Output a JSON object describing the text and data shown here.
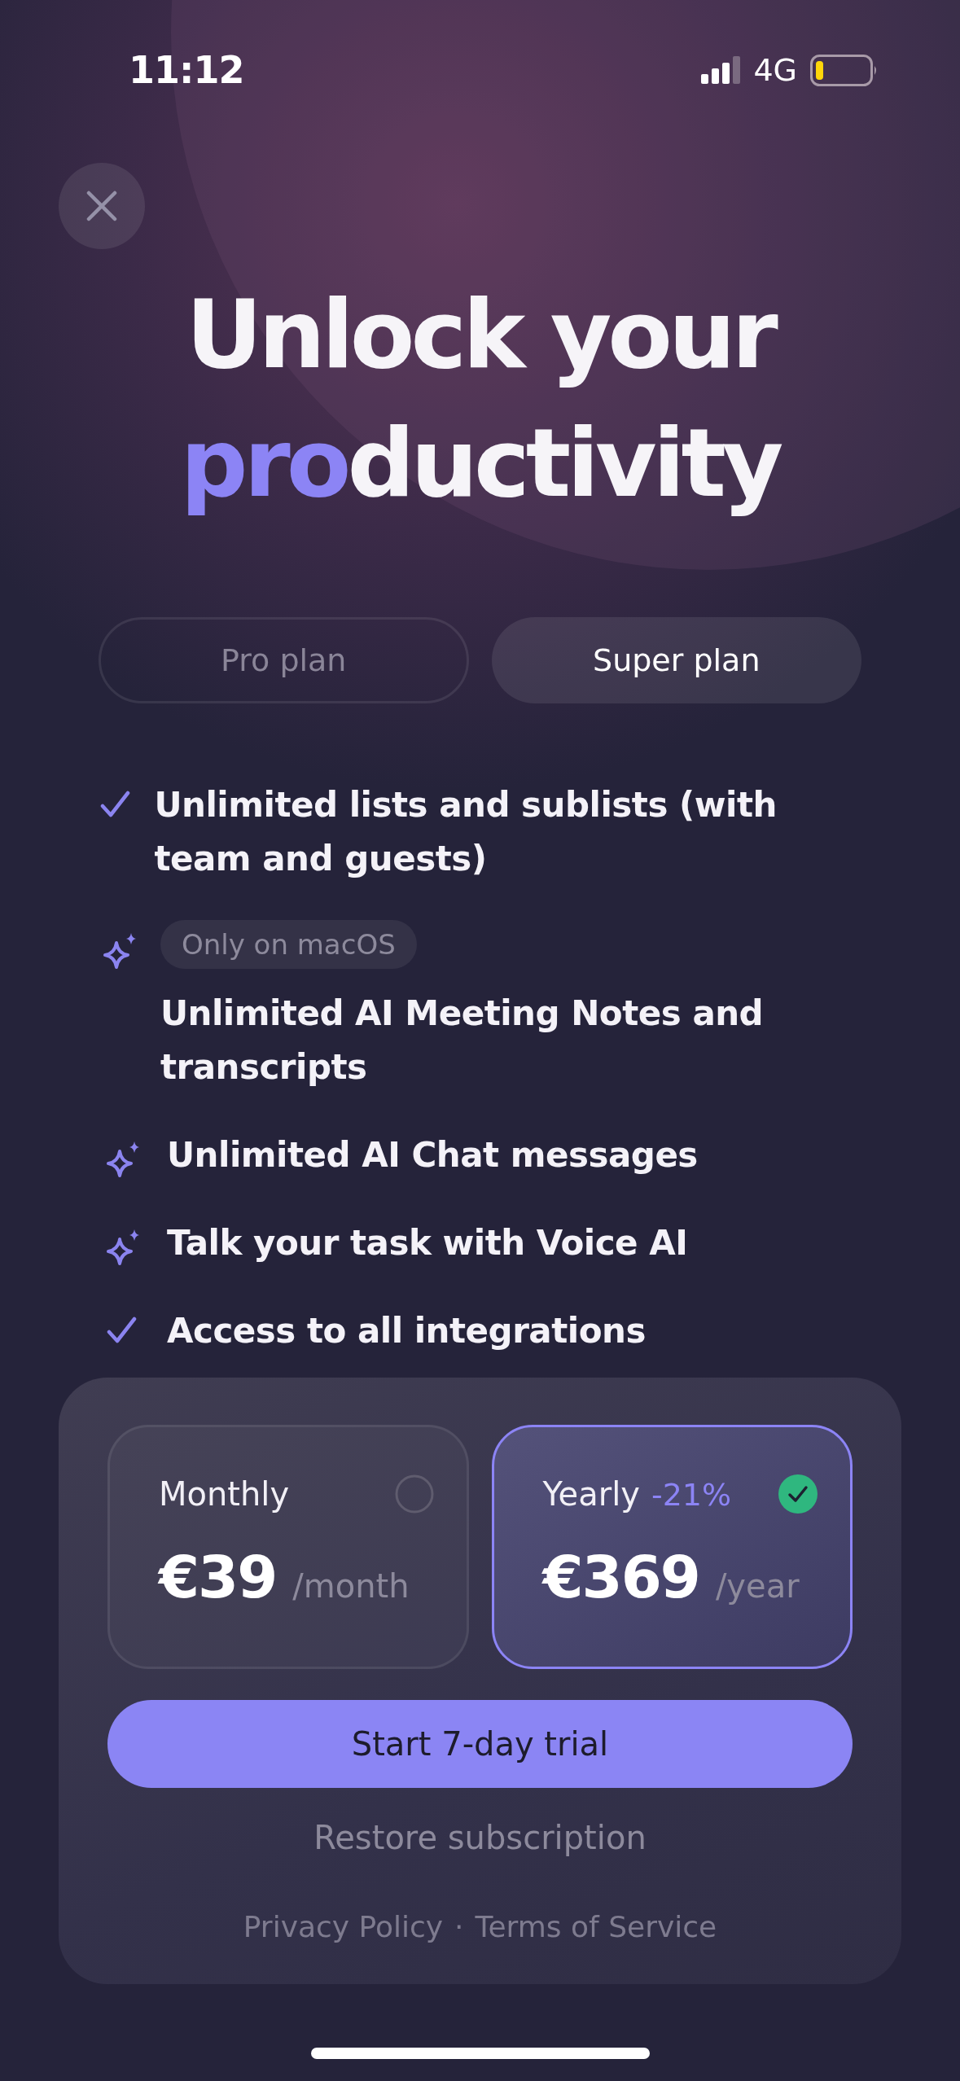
{
  "status_bar": {
    "time": "11:12",
    "network": "4G"
  },
  "headline": {
    "lines": [
      [
        {
          "text": "Unlock your",
          "accent": false
        }
      ],
      [
        {
          "text": "pro",
          "accent": true
        },
        {
          "text": "ductivity",
          "accent": false
        }
      ]
    ]
  },
  "plan_tabs": [
    {
      "label": "Pro plan",
      "selected": false
    },
    {
      "label": "Super plan",
      "selected": true
    }
  ],
  "features": [
    {
      "kind": "check",
      "text": "Unlimited lists and sublists (with team and guests)"
    },
    {
      "kind": "sparkle",
      "badge": "Only on macOS",
      "text": "Unlimited AI Meeting Notes and transcripts"
    },
    {
      "kind": "sparkle",
      "text": "Unlimited AI Chat messages"
    },
    {
      "kind": "sparkle",
      "text": "Talk your task with Voice AI"
    },
    {
      "kind": "check",
      "text": "Access to all integrations"
    }
  ],
  "billing_options": [
    {
      "label": "Monthly",
      "price": "€39",
      "period": "/month",
      "selected": false
    },
    {
      "label": "Yearly",
      "discount": "-21%",
      "price": "€369",
      "period": "/year",
      "selected": true
    }
  ],
  "primary_button": "Start 7-day trial",
  "restore_link": "Restore subscription",
  "footer_links": [
    "Privacy Policy",
    "Terms of Service"
  ],
  "footer_separator": "·"
}
